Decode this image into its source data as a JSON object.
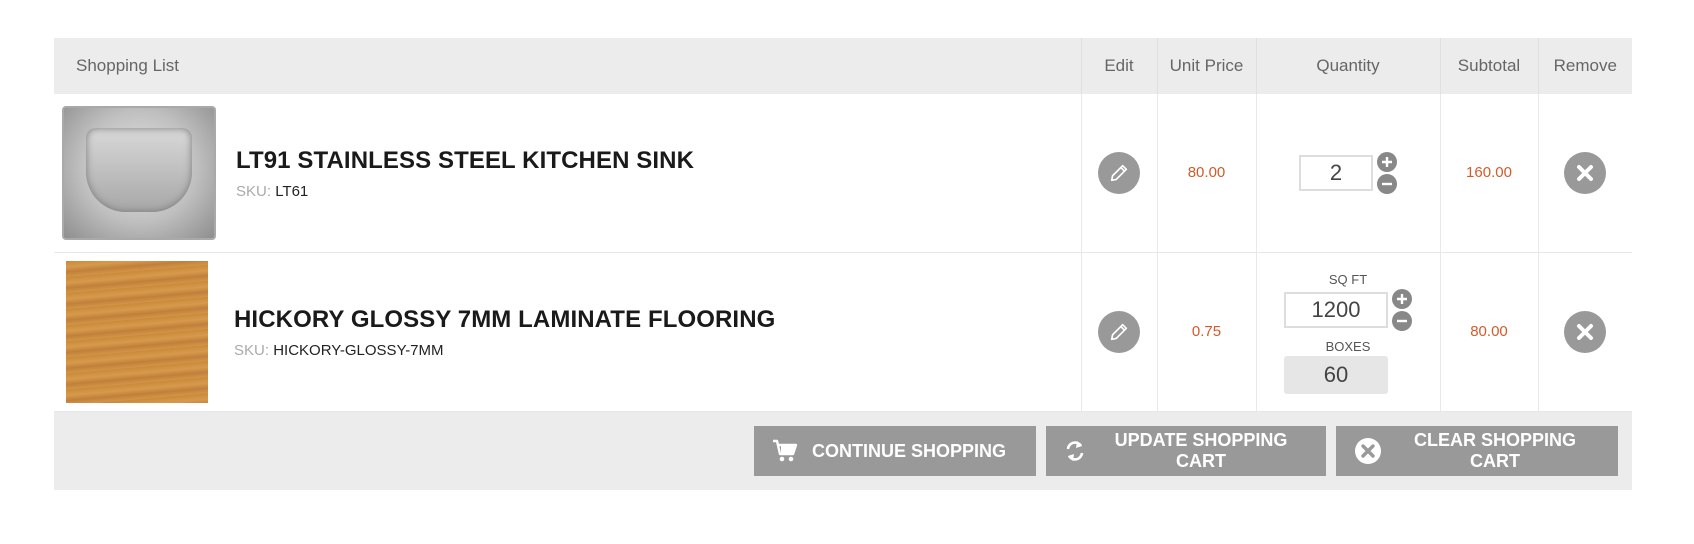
{
  "header": {
    "shopping_list": "Shopping List",
    "edit": "Edit",
    "unit_price": "Unit Price",
    "quantity": "Quantity",
    "subtotal": "Subtotal",
    "remove": "Remove"
  },
  "items": [
    {
      "title": "LT91 STAINLESS STEEL KITCHEN SINK",
      "sku_label": "SKU:",
      "sku": "LT61",
      "unit_price": "80.00",
      "quantity": "2",
      "subtotal": "160.00",
      "image_icon": "sink-image"
    },
    {
      "title": "HICKORY GLOSSY 7MM LAMINATE FLOORING",
      "sku_label": "SKU:",
      "sku": "HICKORY-GLOSSY-7MM",
      "unit_price": "0.75",
      "sqft_label": "SQ FT",
      "quantity": "1200",
      "boxes_label": "BOXES",
      "boxes": "60",
      "subtotal": "80.00",
      "image_icon": "wood-swatch-image"
    }
  ],
  "buttons": {
    "continue": "CONTINUE SHOPPING",
    "update": "UPDATE SHOPPING CART",
    "clear": "CLEAR SHOPPING CART"
  },
  "colors": {
    "price": "#d35a2a",
    "button_bg": "#999999",
    "header_bg": "#ececec"
  }
}
